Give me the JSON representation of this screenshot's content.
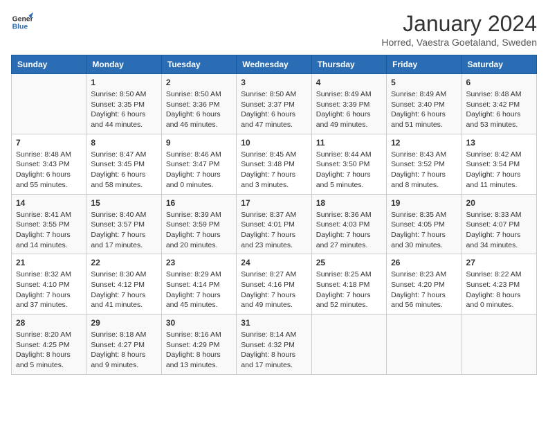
{
  "header": {
    "logo_line1": "General",
    "logo_line2": "Blue",
    "month": "January 2024",
    "location": "Horred, Vaestra Goetaland, Sweden"
  },
  "days_of_week": [
    "Sunday",
    "Monday",
    "Tuesday",
    "Wednesday",
    "Thursday",
    "Friday",
    "Saturday"
  ],
  "weeks": [
    [
      {
        "day": "",
        "info": ""
      },
      {
        "day": "1",
        "info": "Sunrise: 8:50 AM\nSunset: 3:35 PM\nDaylight: 6 hours\nand 44 minutes."
      },
      {
        "day": "2",
        "info": "Sunrise: 8:50 AM\nSunset: 3:36 PM\nDaylight: 6 hours\nand 46 minutes."
      },
      {
        "day": "3",
        "info": "Sunrise: 8:50 AM\nSunset: 3:37 PM\nDaylight: 6 hours\nand 47 minutes."
      },
      {
        "day": "4",
        "info": "Sunrise: 8:49 AM\nSunset: 3:39 PM\nDaylight: 6 hours\nand 49 minutes."
      },
      {
        "day": "5",
        "info": "Sunrise: 8:49 AM\nSunset: 3:40 PM\nDaylight: 6 hours\nand 51 minutes."
      },
      {
        "day": "6",
        "info": "Sunrise: 8:48 AM\nSunset: 3:42 PM\nDaylight: 6 hours\nand 53 minutes."
      }
    ],
    [
      {
        "day": "7",
        "info": "Sunrise: 8:48 AM\nSunset: 3:43 PM\nDaylight: 6 hours\nand 55 minutes."
      },
      {
        "day": "8",
        "info": "Sunrise: 8:47 AM\nSunset: 3:45 PM\nDaylight: 6 hours\nand 58 minutes."
      },
      {
        "day": "9",
        "info": "Sunrise: 8:46 AM\nSunset: 3:47 PM\nDaylight: 7 hours\nand 0 minutes."
      },
      {
        "day": "10",
        "info": "Sunrise: 8:45 AM\nSunset: 3:48 PM\nDaylight: 7 hours\nand 3 minutes."
      },
      {
        "day": "11",
        "info": "Sunrise: 8:44 AM\nSunset: 3:50 PM\nDaylight: 7 hours\nand 5 minutes."
      },
      {
        "day": "12",
        "info": "Sunrise: 8:43 AM\nSunset: 3:52 PM\nDaylight: 7 hours\nand 8 minutes."
      },
      {
        "day": "13",
        "info": "Sunrise: 8:42 AM\nSunset: 3:54 PM\nDaylight: 7 hours\nand 11 minutes."
      }
    ],
    [
      {
        "day": "14",
        "info": "Sunrise: 8:41 AM\nSunset: 3:55 PM\nDaylight: 7 hours\nand 14 minutes."
      },
      {
        "day": "15",
        "info": "Sunrise: 8:40 AM\nSunset: 3:57 PM\nDaylight: 7 hours\nand 17 minutes."
      },
      {
        "day": "16",
        "info": "Sunrise: 8:39 AM\nSunset: 3:59 PM\nDaylight: 7 hours\nand 20 minutes."
      },
      {
        "day": "17",
        "info": "Sunrise: 8:37 AM\nSunset: 4:01 PM\nDaylight: 7 hours\nand 23 minutes."
      },
      {
        "day": "18",
        "info": "Sunrise: 8:36 AM\nSunset: 4:03 PM\nDaylight: 7 hours\nand 27 minutes."
      },
      {
        "day": "19",
        "info": "Sunrise: 8:35 AM\nSunset: 4:05 PM\nDaylight: 7 hours\nand 30 minutes."
      },
      {
        "day": "20",
        "info": "Sunrise: 8:33 AM\nSunset: 4:07 PM\nDaylight: 7 hours\nand 34 minutes."
      }
    ],
    [
      {
        "day": "21",
        "info": "Sunrise: 8:32 AM\nSunset: 4:10 PM\nDaylight: 7 hours\nand 37 minutes."
      },
      {
        "day": "22",
        "info": "Sunrise: 8:30 AM\nSunset: 4:12 PM\nDaylight: 7 hours\nand 41 minutes."
      },
      {
        "day": "23",
        "info": "Sunrise: 8:29 AM\nSunset: 4:14 PM\nDaylight: 7 hours\nand 45 minutes."
      },
      {
        "day": "24",
        "info": "Sunrise: 8:27 AM\nSunset: 4:16 PM\nDaylight: 7 hours\nand 49 minutes."
      },
      {
        "day": "25",
        "info": "Sunrise: 8:25 AM\nSunset: 4:18 PM\nDaylight: 7 hours\nand 52 minutes."
      },
      {
        "day": "26",
        "info": "Sunrise: 8:23 AM\nSunset: 4:20 PM\nDaylight: 7 hours\nand 56 minutes."
      },
      {
        "day": "27",
        "info": "Sunrise: 8:22 AM\nSunset: 4:23 PM\nDaylight: 8 hours\nand 0 minutes."
      }
    ],
    [
      {
        "day": "28",
        "info": "Sunrise: 8:20 AM\nSunset: 4:25 PM\nDaylight: 8 hours\nand 5 minutes."
      },
      {
        "day": "29",
        "info": "Sunrise: 8:18 AM\nSunset: 4:27 PM\nDaylight: 8 hours\nand 9 minutes."
      },
      {
        "day": "30",
        "info": "Sunrise: 8:16 AM\nSunset: 4:29 PM\nDaylight: 8 hours\nand 13 minutes."
      },
      {
        "day": "31",
        "info": "Sunrise: 8:14 AM\nSunset: 4:32 PM\nDaylight: 8 hours\nand 17 minutes."
      },
      {
        "day": "",
        "info": ""
      },
      {
        "day": "",
        "info": ""
      },
      {
        "day": "",
        "info": ""
      }
    ]
  ]
}
